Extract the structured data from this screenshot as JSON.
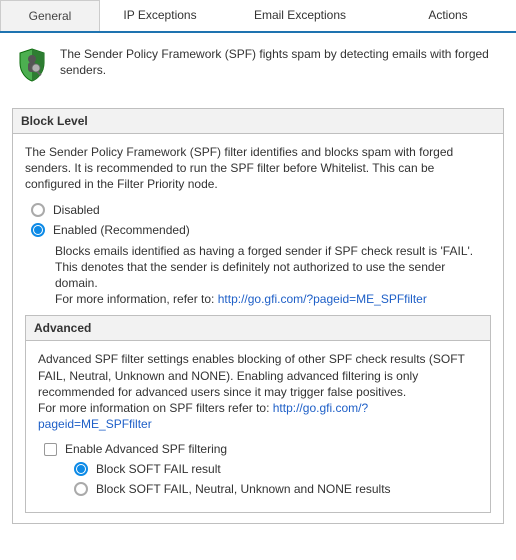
{
  "tabs": {
    "general": "General",
    "ip_exceptions": "IP Exceptions",
    "email_exceptions": "Email Exceptions",
    "actions": "Actions"
  },
  "intro": "The Sender Policy Framework (SPF) fights spam by detecting emails with forged senders.",
  "block_level": {
    "title": "Block Level",
    "description": "The Sender Policy Framework (SPF) filter identifies and blocks spam with forged senders. It is recommended to run the SPF filter before Whitelist. This can be configured in the Filter Priority node.",
    "disabled_label": "Disabled",
    "enabled_label": "Enabled (Recommended)",
    "enabled_note_1": "Blocks emails identified as having a forged sender if SPF check result is 'FAIL'. This denotes that the sender is definitely not authorized to use the sender domain.",
    "enabled_note_2": "For more information, refer to: ",
    "link": "http://go.gfi.com/?pageid=ME_SPFfilter"
  },
  "advanced": {
    "title": "Advanced",
    "description_1": "Advanced SPF filter settings enables blocking of other SPF check results (SOFT FAIL, Neutral, Unknown and NONE). Enabling advanced filtering is only recommended for advanced users since it may trigger false positives.",
    "description_2": "For more information on SPF filters refer to: ",
    "link": "http://go.gfi.com/?pageid=ME_SPFfilter",
    "enable_checkbox": "Enable Advanced SPF filtering",
    "option_softfail": "Block SOFT FAIL result",
    "option_all": "Block SOFT FAIL, Neutral, Unknown and NONE results"
  }
}
